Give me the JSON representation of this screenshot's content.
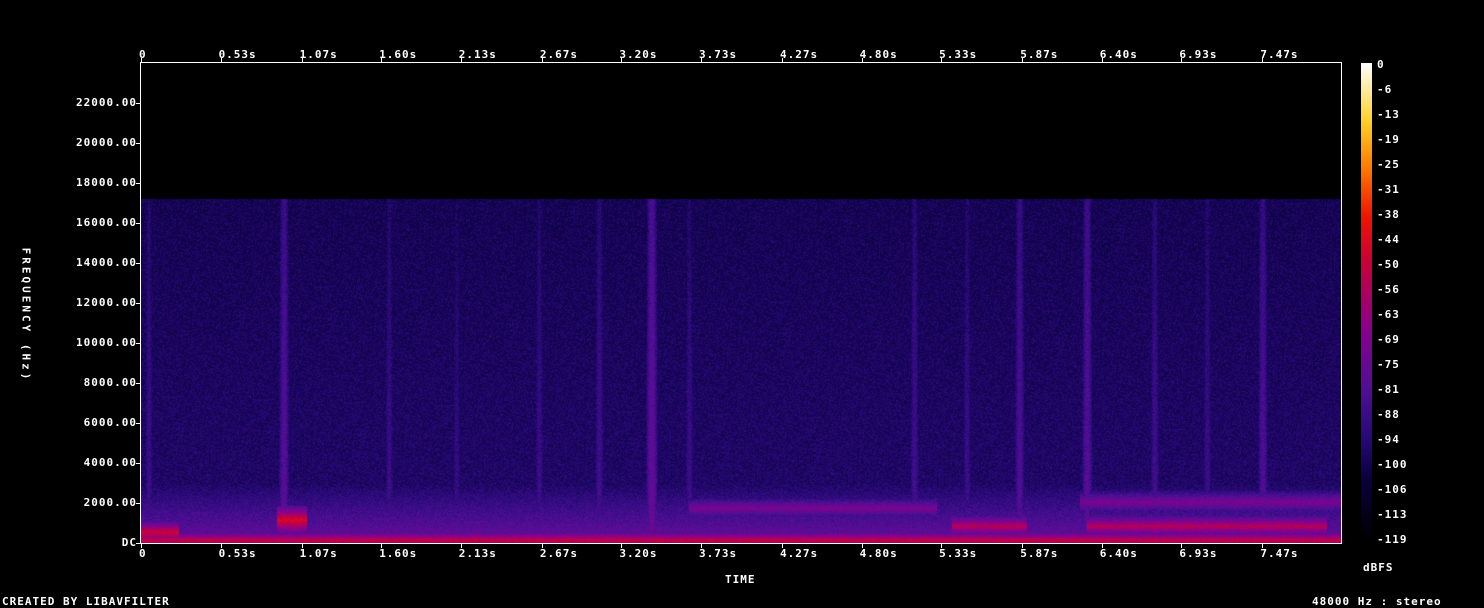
{
  "chart_data": {
    "type": "heatmap",
    "title": "",
    "xlabel": "TIME",
    "ylabel": "FREQUENCY (Hz)",
    "x_ticks": [
      "0",
      "0.53s",
      "1.07s",
      "1.60s",
      "2.13s",
      "2.67s",
      "3.20s",
      "3.73s",
      "4.27s",
      "4.80s",
      "5.33s",
      "5.87s",
      "6.40s",
      "6.93s",
      "7.47s"
    ],
    "x_tick_values": [
      0,
      0.53,
      1.07,
      1.6,
      2.13,
      2.67,
      3.2,
      3.73,
      4.27,
      4.8,
      5.33,
      5.87,
      6.4,
      6.93,
      7.47
    ],
    "xlim": [
      0,
      8.0
    ],
    "y_ticks": [
      "22000.00",
      "20000.00",
      "18000.00",
      "16000.00",
      "14000.00",
      "12000.00",
      "10000.00",
      "8000.00",
      "6000.00",
      "4000.00",
      "2000.00",
      "DC"
    ],
    "y_tick_values": [
      22000,
      20000,
      18000,
      16000,
      14000,
      12000,
      10000,
      8000,
      6000,
      4000,
      2000,
      0
    ],
    "ylim": [
      0,
      24000
    ],
    "colorbar": {
      "label": "dBFS",
      "ticks": [
        "0",
        "-6",
        "-13",
        "-19",
        "-25",
        "-31",
        "-38",
        "-44",
        "-50",
        "-56",
        "-63",
        "-69",
        "-75",
        "-81",
        "-88",
        "-94",
        "-100",
        "-106",
        "-113",
        "-119"
      ],
      "range": [
        -120,
        0
      ]
    },
    "series": [
      {
        "cutoff_hz": 17200,
        "noise_floor_dbfs": -96,
        "vertical_bursts": [
          {
            "t": 0.05,
            "level": -86
          },
          {
            "t": 0.95,
            "level": -78
          },
          {
            "t": 1.65,
            "level": -86
          },
          {
            "t": 2.1,
            "level": -88
          },
          {
            "t": 2.65,
            "level": -86
          },
          {
            "t": 3.05,
            "level": -84
          },
          {
            "t": 3.4,
            "level": -74
          },
          {
            "t": 3.65,
            "level": -86
          },
          {
            "t": 5.15,
            "level": -84
          },
          {
            "t": 5.5,
            "level": -86
          },
          {
            "t": 5.85,
            "level": -80
          },
          {
            "t": 6.3,
            "level": -78
          },
          {
            "t": 6.75,
            "level": -84
          },
          {
            "t": 7.1,
            "level": -86
          },
          {
            "t": 7.47,
            "level": -80
          }
        ],
        "harmonic_bands": [
          {
            "t_start": 0.0,
            "t_end": 8.0,
            "freq_hz": 200,
            "level": -50
          },
          {
            "t_start": 0.0,
            "t_end": 0.25,
            "freq_hz": 600,
            "level": -48
          },
          {
            "t_start": 0.9,
            "t_end": 1.1,
            "freq_hz": 1200,
            "level": -45
          },
          {
            "t_start": 3.65,
            "t_end": 5.3,
            "freq_hz": 1800,
            "level": -70
          },
          {
            "t_start": 6.25,
            "t_end": 8.0,
            "freq_hz": 2100,
            "level": -70
          },
          {
            "t_start": 5.4,
            "t_end": 5.9,
            "freq_hz": 900,
            "level": -55
          },
          {
            "t_start": 6.3,
            "t_end": 7.9,
            "freq_hz": 900,
            "level": -55
          }
        ]
      }
    ]
  },
  "footer": {
    "left": "CREATED BY LIBAVFILTER",
    "right": "48000 Hz : stereo"
  }
}
